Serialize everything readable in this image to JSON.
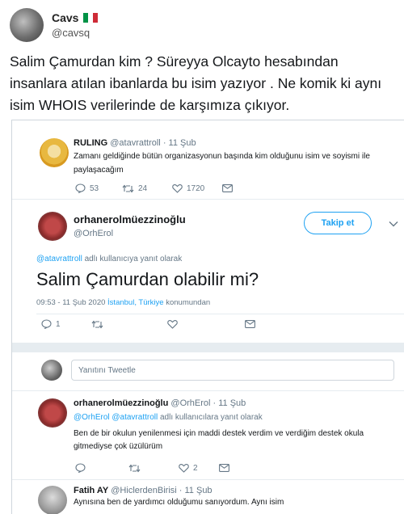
{
  "outer": {
    "name": "Cavs",
    "handle": "@cavsq",
    "flag_colors": [
      "#009246",
      "#ffffff",
      "#ce2b37"
    ],
    "text": "Salim Çamurdan kim ? Süreyya Olcayto hesabından insanlara atılan ibanlarda bu isim yazıyor . Ne komik ki aynı isim WHOIS verilerinde de karşımıza çıkıyor."
  },
  "tweet1": {
    "name": "RULING",
    "handle": "@atavrattroll",
    "date": "· 11 Şub",
    "text": "Zamanı geldiğinde bütün organizasyonun başında kim olduğunu isim ve soyismi ile paylaşacağım",
    "replies": "53",
    "retweets": "24",
    "likes": "1720"
  },
  "tweet2": {
    "name": "orhanerolmüezzinoğlu",
    "handle": "@OrhErol",
    "follow_label": "Takip et",
    "reply_context_user": "@atavrattroll",
    "reply_context_text": " adlı kullanıcıya yanıt olarak",
    "text": "Salim Çamurdan olabilir mi?",
    "meta_time": "09:53 - 11 Şub 2020 ",
    "meta_location": "İstanbul, Türkiye",
    "meta_suffix": " konumundan",
    "replies": "1"
  },
  "reply_box": {
    "placeholder": "Yanıtını Tweetle"
  },
  "tweet3": {
    "name": "orhanerolmüezzinoğlu",
    "handle_date": "@OrhErol · 11 Şub",
    "reply_context_users": "@OrhErol @atavrattroll",
    "reply_context_text": " adlı kullanıcılara yanıt olarak",
    "text": "Ben de bir okulun yenilenmesi için maddi destek verdim ve verdiğim destek okula gitmediyse çok üzülürüm",
    "likes": "2"
  },
  "tweet4": {
    "name": "Fatih AY",
    "handle_date": "@HiclerdenBirisi · 11 Şub",
    "text": "Aynısına ben de yardımcı olduğumu sanıyordum. Aynı isim"
  }
}
